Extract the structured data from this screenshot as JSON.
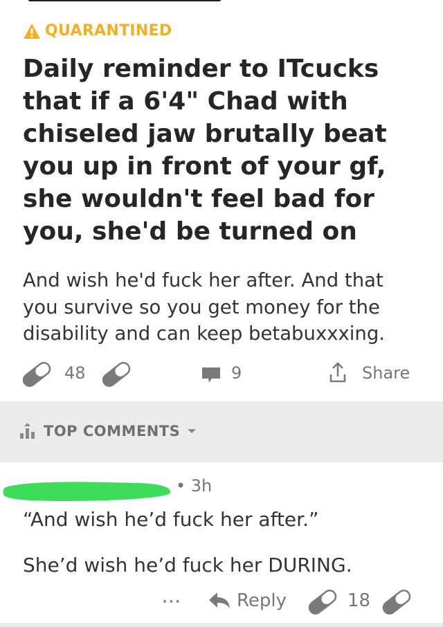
{
  "post": {
    "badge": "QUARANTINED",
    "title": "Daily reminder to ITcucks that if a 6'4\" Chad with chiseled jaw brutally beat you up in front of your gf, she wouldn't feel bad for you, she'd be turned on",
    "body": "And wish he'd fuck her after. And that you survive so you get money for the disability and can keep betabuxxxing.",
    "score": "48",
    "comments_count": "9",
    "share_label": "Share"
  },
  "sort": {
    "label": "TOP COMMENTS"
  },
  "comment": {
    "time": "• 3h",
    "line1": "“And wish he’d fuck her after.”",
    "line2": "She’d wish he’d fuck her DURING.",
    "more": "•••",
    "reply_label": "Reply",
    "score": "18"
  },
  "colors": {
    "quarantine": "#f2b01e",
    "vote_icon": "#7a7a7a",
    "redaction": "#3ddc5a"
  },
  "icons": [
    "warning-icon",
    "upvote-pill-icon",
    "downvote-pill-icon",
    "comment-icon",
    "share-icon",
    "sort-icon",
    "chevron-down-icon",
    "reply-icon",
    "more-icon"
  ]
}
